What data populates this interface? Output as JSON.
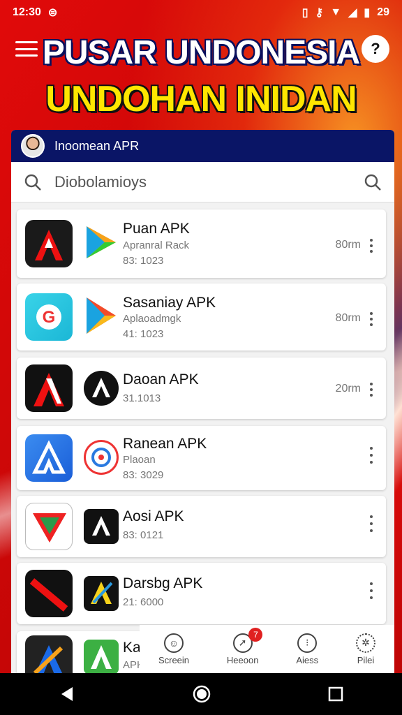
{
  "status": {
    "time": "12:30",
    "battery": "29"
  },
  "header": {
    "title_line1": "PUSAR UNDONESIA",
    "title_line2": "UNDOHAN INIDAN"
  },
  "panel": {
    "account_name": "Inoomean APR"
  },
  "search": {
    "value": "Diobolamioys"
  },
  "apps": [
    {
      "name": "Puan APK",
      "subtitle": "Apranral Rack",
      "date": "83: 1023",
      "size": "80rm"
    },
    {
      "name": "Sasaniay APK",
      "subtitle": "Aplaoadmgk",
      "date": "41: 1023",
      "size": "80rm"
    },
    {
      "name": "Daoan APK",
      "subtitle": "",
      "date": "31.1013",
      "size": "20rm"
    },
    {
      "name": "Ranean APK",
      "subtitle": "Plaoan",
      "date": "83: 3029",
      "size": ""
    },
    {
      "name": "Aosi APK",
      "subtitle": "",
      "date": "83: 0121",
      "size": ""
    },
    {
      "name": "Darsbg APK",
      "subtitle": "",
      "date": "21: 6000",
      "size": ""
    },
    {
      "name": "Kaml",
      "subtitle": "APK",
      "date": "",
      "size": ""
    }
  ],
  "bottom_nav": [
    {
      "label": "Screein",
      "icon": "face-icon"
    },
    {
      "label": "Heeoon",
      "icon": "compass-icon",
      "badge": "7"
    },
    {
      "label": "Aiess",
      "icon": "dots-icon"
    },
    {
      "label": "Pilei",
      "icon": "gear-icon"
    }
  ],
  "colors": {
    "panel_header": "#0a1566",
    "title_yellow": "#ffe600",
    "badge_red": "#e02020"
  }
}
